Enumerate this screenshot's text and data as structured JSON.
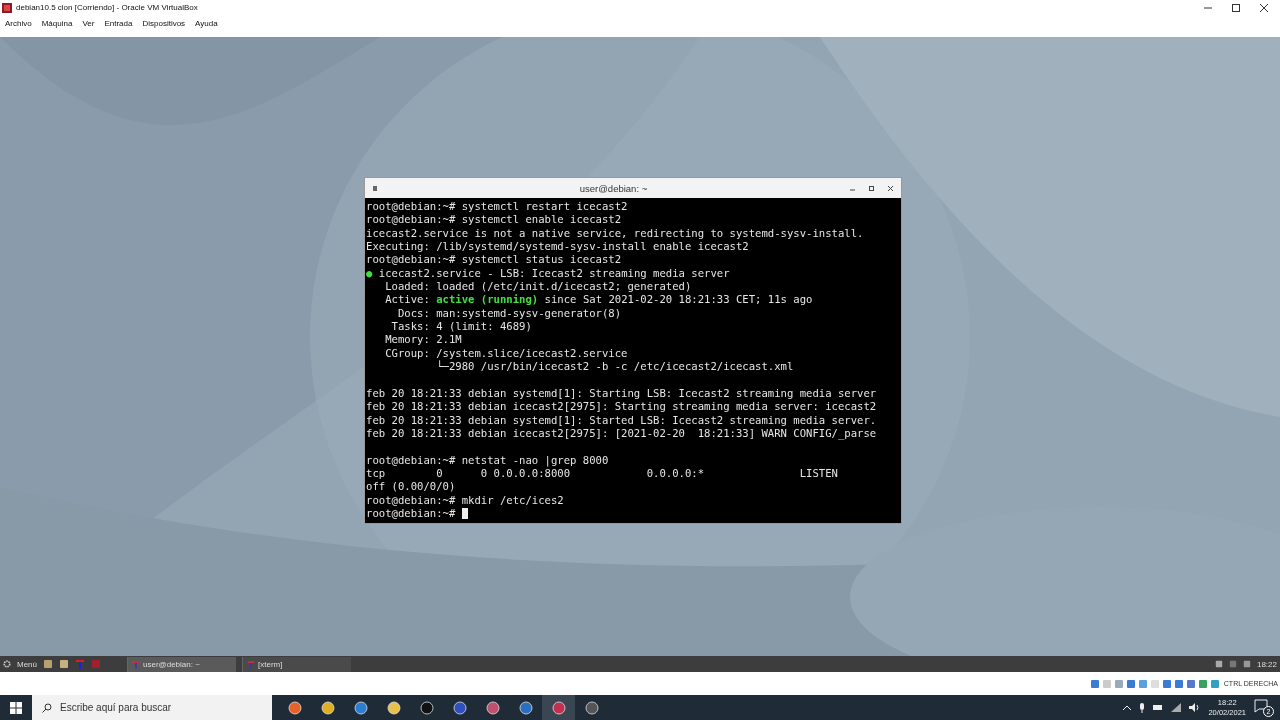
{
  "window": {
    "title": "debian10.5 clon [Corriendo] - Oracle VM VirtualBox"
  },
  "menu": [
    "Archivo",
    "Máquina",
    "Ver",
    "Entrada",
    "Dispositivos",
    "Ayuda"
  ],
  "terminal": {
    "title": "user@debian: ~",
    "lines": [
      {
        "kind": "text",
        "segments": [
          {
            "kind": "plain",
            "text": "root@debian:~# systemctl restart icecast2"
          }
        ]
      },
      {
        "kind": "text",
        "segments": [
          {
            "kind": "plain",
            "text": "root@debian:~# systemctl enable icecast2"
          }
        ]
      },
      {
        "kind": "text",
        "segments": [
          {
            "kind": "plain",
            "text": "icecast2.service is not a native service, redirecting to systemd-sysv-install."
          }
        ]
      },
      {
        "kind": "text",
        "segments": [
          {
            "kind": "plain",
            "text": "Executing: /lib/systemd/systemd-sysv-install enable icecast2"
          }
        ]
      },
      {
        "kind": "text",
        "segments": [
          {
            "kind": "plain",
            "text": "root@debian:~# systemctl status icecast2"
          }
        ]
      },
      {
        "kind": "text",
        "segments": [
          {
            "kind": "green",
            "text": "●"
          },
          {
            "kind": "plain",
            "text": " icecast2.service - LSB: Icecast2 streaming media server"
          }
        ]
      },
      {
        "kind": "text",
        "segments": [
          {
            "kind": "plain",
            "text": "   Loaded: loaded (/etc/init.d/icecast2; generated)"
          }
        ]
      },
      {
        "kind": "text",
        "segments": [
          {
            "kind": "plain",
            "text": "   Active: "
          },
          {
            "kind": "green",
            "text": "active (running)"
          },
          {
            "kind": "plain",
            "text": " since Sat 2021-02-20 18:21:33 CET; 11s ago"
          }
        ]
      },
      {
        "kind": "text",
        "segments": [
          {
            "kind": "plain",
            "text": "     Docs: man:systemd-sysv-generator(8)"
          }
        ]
      },
      {
        "kind": "text",
        "segments": [
          {
            "kind": "plain",
            "text": "    Tasks: 4 (limit: 4689)"
          }
        ]
      },
      {
        "kind": "text",
        "segments": [
          {
            "kind": "plain",
            "text": "   Memory: 2.1M"
          }
        ]
      },
      {
        "kind": "text",
        "segments": [
          {
            "kind": "plain",
            "text": "   CGroup: /system.slice/icecast2.service"
          }
        ]
      },
      {
        "kind": "text",
        "segments": [
          {
            "kind": "plain",
            "text": "           └─2980 /usr/bin/icecast2 -b -c /etc/icecast2/icecast.xml"
          }
        ]
      },
      {
        "kind": "blank"
      },
      {
        "kind": "text",
        "segments": [
          {
            "kind": "plain",
            "text": "feb 20 18:21:33 debian systemd[1]: Starting LSB: Icecast2 streaming media server"
          }
        ]
      },
      {
        "kind": "text",
        "segments": [
          {
            "kind": "plain",
            "text": "feb 20 18:21:33 debian icecast2[2975]: Starting streaming media server: icecast2"
          }
        ]
      },
      {
        "kind": "text",
        "segments": [
          {
            "kind": "plain",
            "text": "feb 20 18:21:33 debian systemd[1]: Started LSB: Icecast2 streaming media server."
          }
        ]
      },
      {
        "kind": "text",
        "segments": [
          {
            "kind": "plain",
            "text": "feb 20 18:21:33 debian icecast2[2975]: [2021-02-20  18:21:33] WARN CONFIG/_parse"
          }
        ]
      },
      {
        "kind": "blank"
      },
      {
        "kind": "text",
        "segments": [
          {
            "kind": "plain",
            "text": "root@debian:~# netstat -nao |grep 8000"
          }
        ]
      },
      {
        "kind": "text",
        "segments": [
          {
            "kind": "plain",
            "text": "tcp        0      0 0.0.0.0:8000            0.0.0.0:*               LISTEN"
          }
        ]
      },
      {
        "kind": "text",
        "segments": [
          {
            "kind": "plain",
            "text": "off (0.00/0/0)"
          }
        ]
      },
      {
        "kind": "text",
        "segments": [
          {
            "kind": "plain",
            "text": "root@debian:~# mkdir /etc/ices2"
          }
        ]
      },
      {
        "kind": "text",
        "cursor": true,
        "segments": [
          {
            "kind": "plain",
            "text": "root@debian:~# "
          }
        ]
      }
    ]
  },
  "panel": {
    "menu_label": "Menú",
    "tasks": [
      {
        "label": "user@debian: ~",
        "selected": true
      },
      {
        "label": "[xterm]",
        "selected": false
      }
    ],
    "clock": "18:22"
  },
  "vbox_status": {
    "host_key": "CTRL DERECHA"
  },
  "taskbar": {
    "search_placeholder": "Escribe aquí para buscar",
    "time": "18:22",
    "date": "20/02/2021",
    "notifications": "2"
  }
}
